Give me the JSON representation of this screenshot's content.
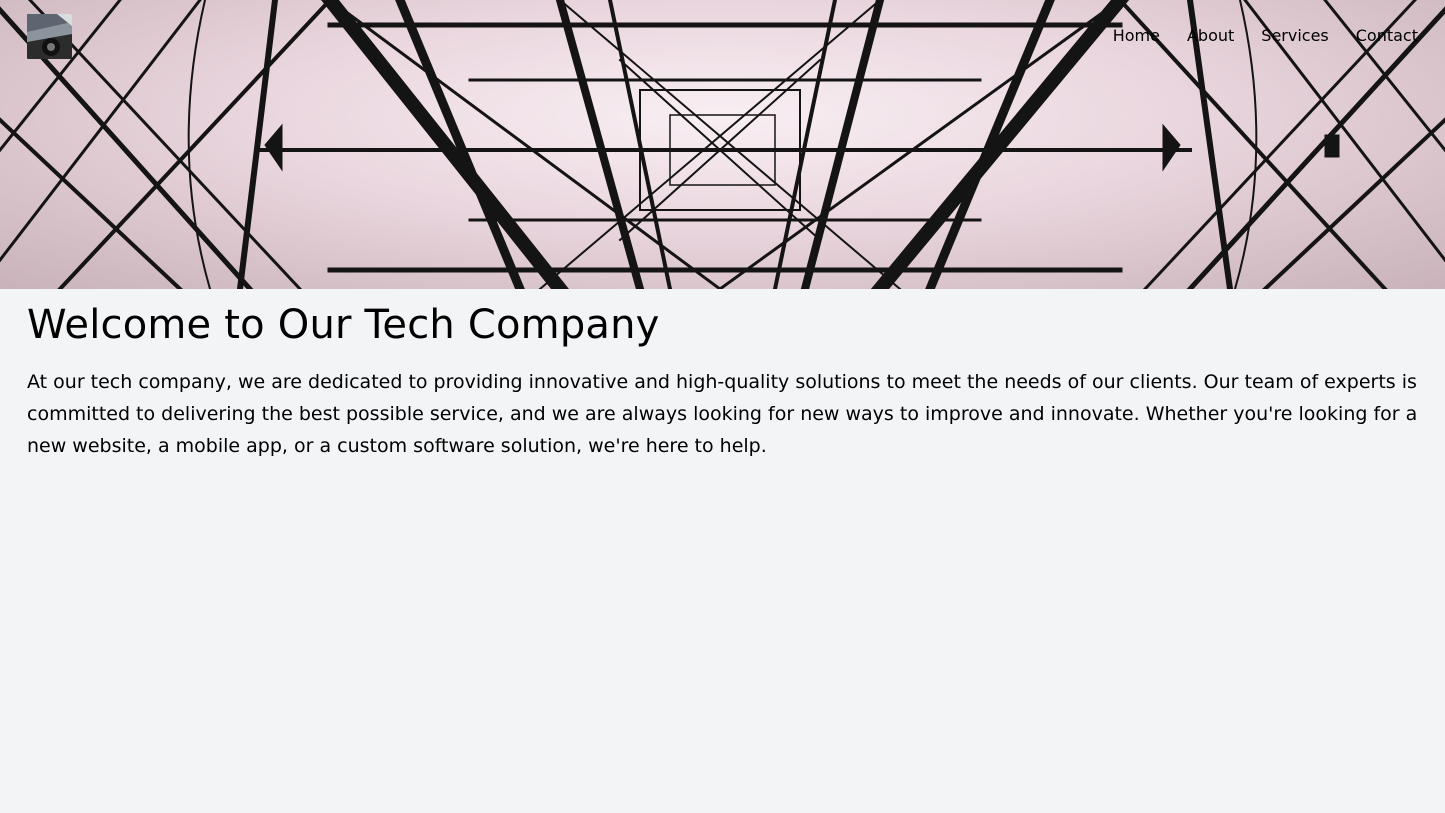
{
  "header": {
    "logo_icon": "photo-thumbnail-icon",
    "nav": [
      {
        "label": "Home"
      },
      {
        "label": "About"
      },
      {
        "label": "Services"
      },
      {
        "label": "Contact"
      }
    ]
  },
  "hero": {
    "image": "steel-tower-lattice-photo"
  },
  "main": {
    "title": "Welcome to Our Tech Company",
    "intro": "At our tech company, we are dedicated to providing innovative and high-quality solutions to meet the needs of our clients. Our team of experts is committed to delivering the best possible service, and we are always looking for new ways to improve and innovate. Whether you're looking for a new website, a mobile app, or a custom software solution, we're here to help."
  },
  "colors": {
    "page_background": "#f3f4f6",
    "text": "#000000",
    "hero_tint": "#ead6de"
  }
}
